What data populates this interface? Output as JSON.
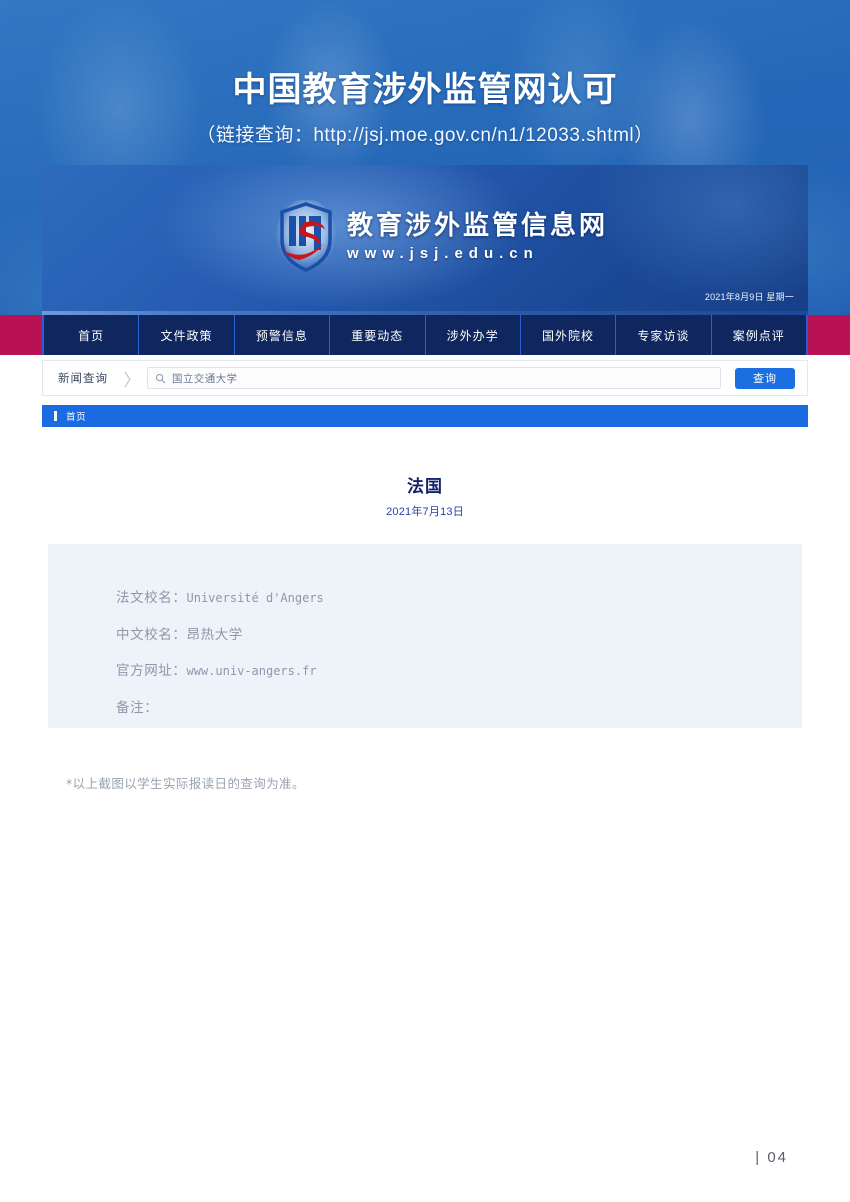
{
  "hero": {
    "title": "中国教育涉外监管网认可",
    "subtitle": "（链接查询：http://jsj.moe.gov.cn/n1/12033.shtml）"
  },
  "site": {
    "logo_icon": "jsj-shield-logo",
    "logo_name_cn": "教育涉外监管信息网",
    "logo_url": "www.jsj.edu.cn",
    "date": "2021年8月9日 星期一",
    "nav": [
      {
        "label": "首页",
        "name": "nav-item-home"
      },
      {
        "label": "文件政策",
        "name": "nav-item-policy"
      },
      {
        "label": "预警信息",
        "name": "nav-item-warning"
      },
      {
        "label": "重要动态",
        "name": "nav-item-news"
      },
      {
        "label": "涉外办学",
        "name": "nav-item-foreign-school"
      },
      {
        "label": "国外院校",
        "name": "nav-item-overseas-institutions"
      },
      {
        "label": "专家访谈",
        "name": "nav-item-expert-interview"
      },
      {
        "label": "案例点评",
        "name": "nav-item-case-review"
      }
    ],
    "search": {
      "label": "新闻查询",
      "separator": "〉",
      "icon": "search-icon",
      "value": "国立交通大学",
      "placeholder": "国立交通大学",
      "button_label": "查询",
      "button_color": "#1b6fe0"
    },
    "breadcrumb": {
      "text": "首页",
      "bar_color": "#1a6ae2"
    }
  },
  "article": {
    "title": "法国",
    "date": "2021年7月13日",
    "title_color": "#13246b",
    "date_color": "#2b43a8",
    "infobox": {
      "background": "#eef3fa",
      "rows": [
        {
          "label": "法文校名：",
          "value": "Université d'Angers"
        },
        {
          "label": "中文校名：",
          "value": "昂热大学"
        },
        {
          "label": "官方网址：",
          "value": "www.univ-angers.fr"
        },
        {
          "label": "备注：",
          "value": ""
        }
      ]
    }
  },
  "footnote": "*以上截图以学生实际报读日的查询为准。",
  "page_number": "| 04",
  "accents": {
    "crimson": "#b81254",
    "nav_navy": "#10265e",
    "nav_divider": "#2a5fd0"
  }
}
